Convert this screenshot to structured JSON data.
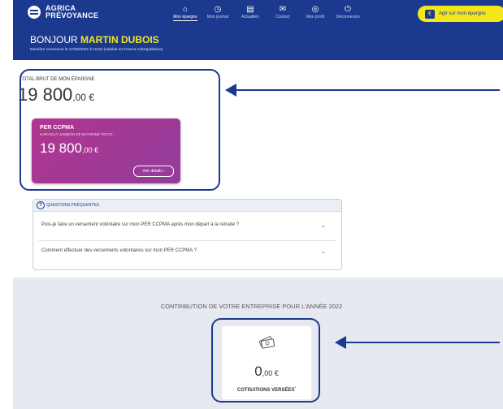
{
  "brand": {
    "line1": "AGRICA",
    "line2": "PRÉVOYANCE"
  },
  "nav": {
    "items": [
      {
        "label": "Mon épargne",
        "icon": "home-icon",
        "glyph": "⌂"
      },
      {
        "label": "Mon journal",
        "icon": "clock-icon",
        "glyph": "◷"
      },
      {
        "label": "Actualités",
        "icon": "news-icon",
        "glyph": "▤"
      },
      {
        "label": "Contact",
        "icon": "mail-icon",
        "glyph": "✉"
      },
      {
        "label": "Mon profil",
        "icon": "user-icon",
        "glyph": "◎"
      },
      {
        "label": "Déconnexion",
        "icon": "power-icon",
        "glyph": "⏻"
      }
    ]
  },
  "cta": {
    "label": "Agir sur mon épargne",
    "icon": "wallet-icon"
  },
  "hero": {
    "greeting_prefix": "BONJOUR ",
    "user_name": "MARTIN DUBOIS",
    "last_login": "Dernière connexion le 27/06/2022 à 15:53 (valable en France métropolitaine)"
  },
  "savings": {
    "total_label": "TOTAL BRUT DE MON ÉPARGNE",
    "total_int": "19 800",
    "total_cents": ",00 €"
  },
  "per_card": {
    "title": "PER CCPMA",
    "subtitle": "HARAGUY JAMBON DE BAYONNE TEST2",
    "amount_int": "19 800",
    "amount_cents": ",00 €",
    "details_label": "Voir détails",
    "details_icon": "chevron-right-icon"
  },
  "faq": {
    "title": "QUESTIONS FRÉQUENTES",
    "questions": [
      "Puis-je faire un versement volontaire sur mon PER CCPMA après mon départ à la retraite ?",
      "Comment effectuer des versements volontaires sur mon PER CCPMA ?"
    ]
  },
  "contribution": {
    "title": "CONTRIBUTION DE VOTRE ENTREPRISE POUR L'ANNÉE 2022",
    "amount_int": "0",
    "amount_cents": ",00 €",
    "label": "COTISATIONS VERSÉES",
    "footnote": "*",
    "icon": "money-icon"
  },
  "colors": {
    "brand_blue": "#1b3a8f",
    "accent_yellow": "#f3e61b",
    "card_magenta": "#a5388f",
    "grey_band": "#e7e9f0"
  }
}
